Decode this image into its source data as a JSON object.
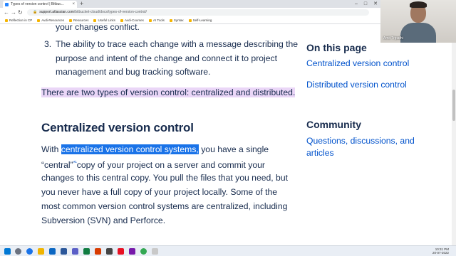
{
  "browser": {
    "tab_title": "Types of version control | Bitbuc...",
    "new_tab": "+",
    "tab_close": "×",
    "win_min": "–",
    "win_max": "□",
    "win_close": "✕",
    "url_host": "support.atlassian.com",
    "url_path": "/bitbucket-cloud/docs/types-of-version-control/",
    "bookmarks": [
      "Reflection in CP",
      "Avdi-Resources",
      "Resources",
      "Useful Links",
      "Avdi-Courses",
      "AI Tools",
      "Syntax",
      "Self-Learning"
    ]
  },
  "article": {
    "line_conflict": "your changes conflict.",
    "item3_number": "3.",
    "item3_line1": "The ability to trace each change with a message describing the",
    "item3_line2": "purpose and intent of the change and connect it to project",
    "item3_line3": "management and bug tracking software.",
    "two_types": "There are two types of version control: centralized and distributed.",
    "heading_centralized": "Centralized version control",
    "p1_prefix": "With ",
    "p1_highlight": "centralized version control systems,",
    "p1_suffix": " you have a single",
    "p2_a": "“central”",
    "p2_sup": "*¹",
    "p2_b": "copy of your project on a server and commit your",
    "p3": "changes to this central copy. You pull the files that you need, but",
    "p4": "you never have a full copy of your project locally. Some of the",
    "p5": "most common version control systems are centralized, including",
    "p6": "Subversion (SVN) and Perforce."
  },
  "sidebar": {
    "on_this_page": "On this page",
    "links": [
      "Centralized version control",
      "Distributed version control"
    ],
    "community": "Community",
    "community_link_1": "Questions, discussions, and",
    "community_link_2": "articles"
  },
  "webcam": {
    "name": "Amit Tripathi"
  },
  "taskbar": {
    "time": "10:31 PM",
    "date": "20-07-2022"
  },
  "colors": {
    "text": "#172b4d",
    "link": "#0052cc",
    "highlight_purple": "#ead6f7",
    "selection_blue": "#1a73e8"
  }
}
